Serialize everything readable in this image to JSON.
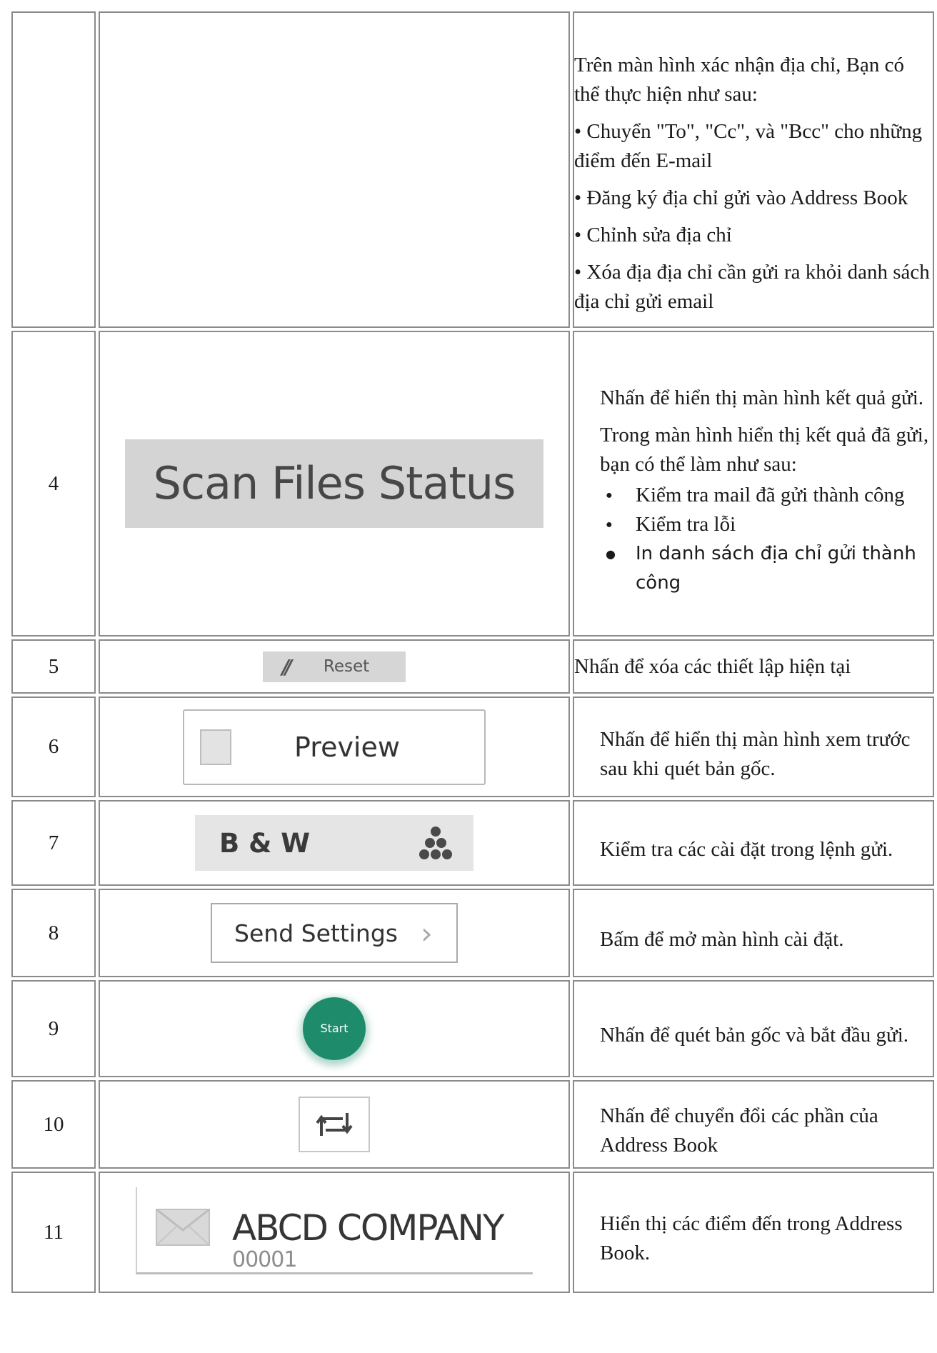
{
  "rows": [
    {
      "num": "",
      "desc_lines": [
        "Trên màn hình xác nhận địa chỉ, Bạn có thể thực hiện như sau:",
        "• Chuyển \"To\", \"Cc\", và \"Bcc\" cho những điểm đến E-mail",
        "• Đăng ký địa chỉ gửi vào Address Book",
        "• Chỉnh sửa địa chỉ",
        "• Xóa địa địa chỉ cần gửi ra khỏi danh sách địa chỉ gửi email"
      ]
    },
    {
      "num": "4",
      "button_label": "Scan Files Status",
      "desc_intro": "Nhấn để hiển thị màn hình kết quả gửi.",
      "desc_intro2": "Trong màn hình hiển thị kết quả đã gửi, bạn có thể làm như sau:",
      "bullets": [
        "Kiểm tra mail đã gửi thành công",
        "Kiểm tra lỗi",
        "In danh sách địa chỉ gửi thành công"
      ]
    },
    {
      "num": "5",
      "button_label": "Reset",
      "desc": "Nhấn để xóa các thiết lập hiện tại"
    },
    {
      "num": "6",
      "button_label": "Preview",
      "desc": "Nhấn để hiển thị màn hình xem trước sau khi quét bản gốc."
    },
    {
      "num": "7",
      "button_label": "B & W",
      "desc": "Kiểm tra các cài đặt trong lệnh gửi."
    },
    {
      "num": "8",
      "button_label": "Send Settings",
      "desc": "Bấm để mở màn hình cài đặt."
    },
    {
      "num": "9",
      "button_label": "Start",
      "desc": "Nhấn để quét bản gốc và bắt đầu gửi."
    },
    {
      "num": "10",
      "icon": "switch-arrows-icon",
      "desc": "Nhấn để chuyển đổi các phần của Address Book"
    },
    {
      "num": "11",
      "card_name": "ABCD COMPANY",
      "card_code": "00001",
      "desc": "Hiển thị các điểm đến trong Address Book."
    }
  ],
  "colors": {
    "start_green": "#1e8c6a",
    "button_gray": "#d4d4d4",
    "border_gray": "#8a8a8a"
  }
}
